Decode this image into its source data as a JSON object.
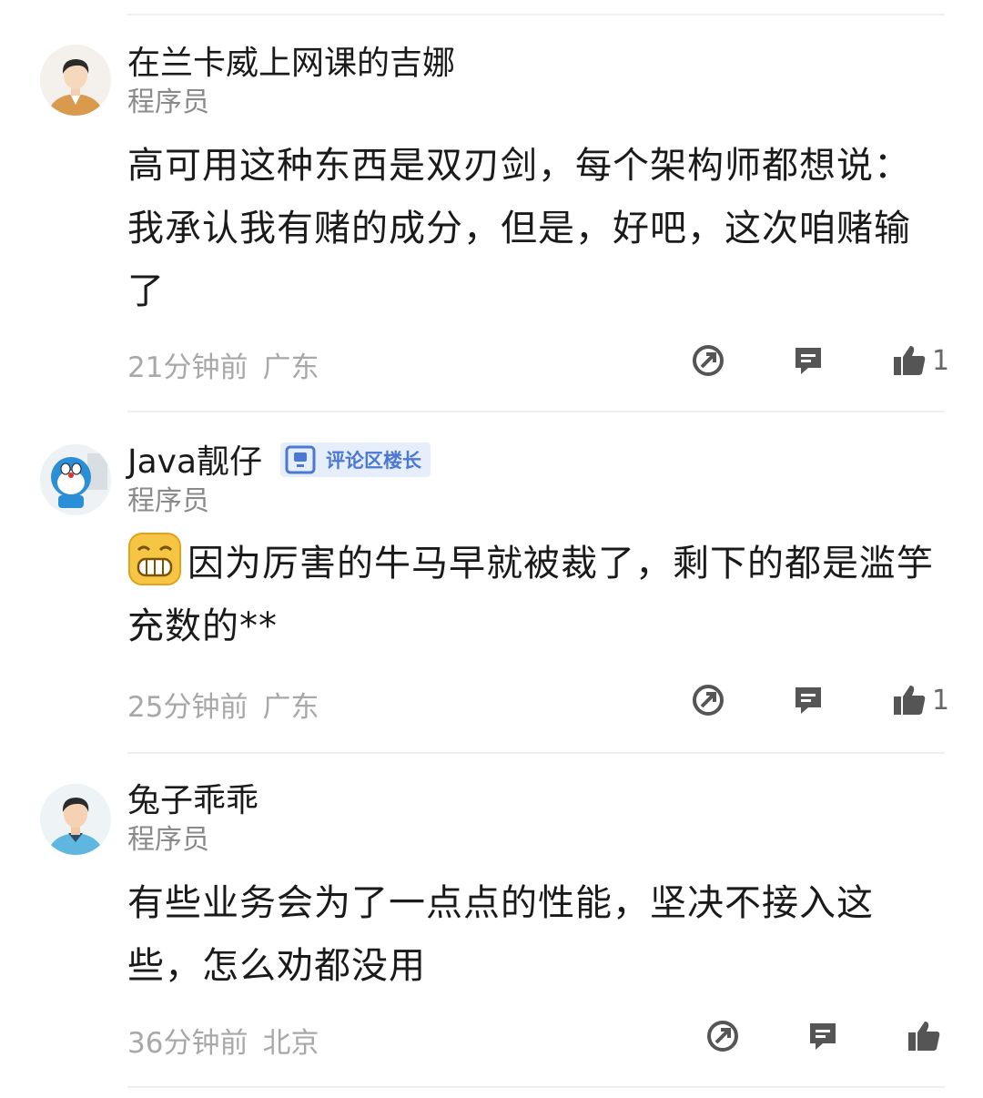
{
  "colors": {
    "text": "#1a1a1a",
    "meta": "#a8a8a8",
    "badge_bg": "#e6eefb",
    "badge_text": "#4a78d4",
    "icon": "#555555"
  },
  "comments": [
    {
      "username": "在兰卡威上网课的吉娜",
      "title": "程序员",
      "avatar_icon": "avatar-man-orange-jacket",
      "content": "高可用这种东西是双刃剑，每个架构师都想说：我承认我有赌的成分，但是，好吧，这次咱赌输了",
      "time": "21分钟前",
      "location": "广东",
      "likes": "1"
    },
    {
      "username": "Java靓仔",
      "badge": "评论区楼长",
      "title": "程序员",
      "avatar_icon": "avatar-doraemon",
      "emoji_icon": "grinning-emoji-icon",
      "content": "因为厉害的牛马早就被裁了，剩下的都是滥竽充数的**",
      "time": "25分钟前",
      "location": "广东",
      "likes": "1"
    },
    {
      "username": "兔子乖乖",
      "title": "程序员",
      "avatar_icon": "avatar-man-blue-shirt",
      "content": "有些业务会为了一点点的性能，坚决不接入这些，怎么劝都没用",
      "time": "36分钟前",
      "location": "北京",
      "likes": ""
    }
  ]
}
